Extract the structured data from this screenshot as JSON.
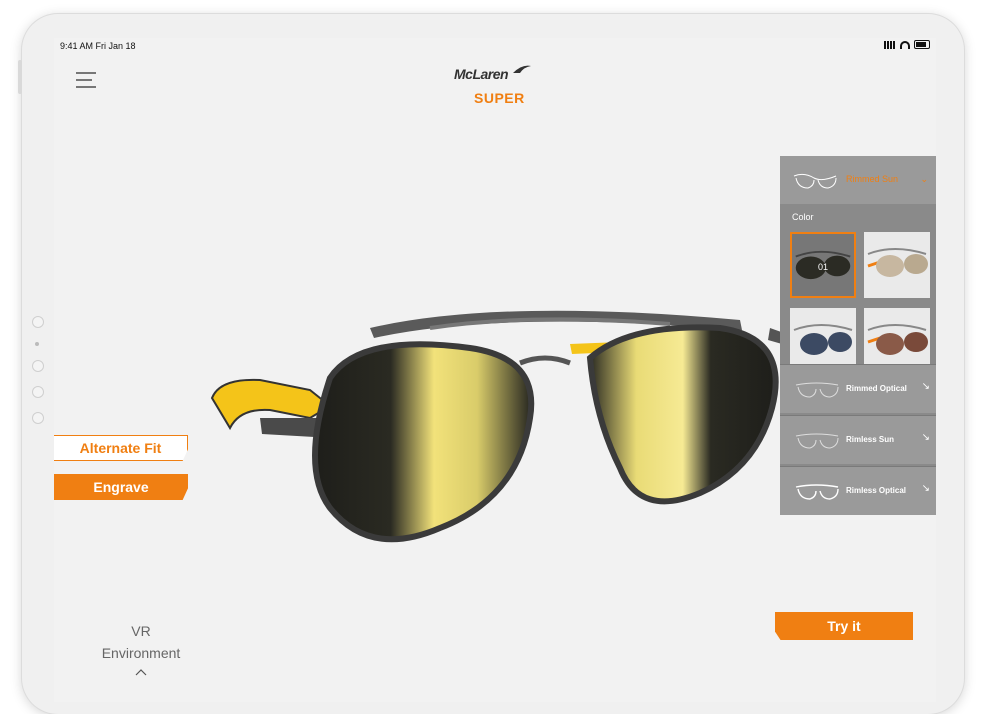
{
  "status": {
    "time": "9:41 AM Fri Jan 18"
  },
  "header": {
    "brand": "McLaren",
    "model": "SUPER"
  },
  "actions": {
    "alternate_fit": "Alternate Fit",
    "engrave": "Engrave",
    "try_it": "Try it"
  },
  "vr": {
    "line1": "VR",
    "line2": "Environment"
  },
  "panel": {
    "current_style": "Rimmed Sun",
    "color_label": "Color",
    "swatches": [
      {
        "label": "01",
        "selected": true,
        "lens": "#2b2b24"
      },
      {
        "label": "",
        "selected": false,
        "lens": "#c7b7a0"
      },
      {
        "label": "",
        "selected": false,
        "lens": "#3c4a63"
      },
      {
        "label": "",
        "selected": false,
        "lens": "#8a5a48"
      }
    ],
    "styles": [
      "Rimmed Optical",
      "Rimless Sun",
      "Rimless Optical"
    ]
  },
  "colors": {
    "accent": "#f07f12",
    "lens_gold": "#f2e27a",
    "frame": "#3a3a3a",
    "temple_yellow": "#f4c419"
  }
}
